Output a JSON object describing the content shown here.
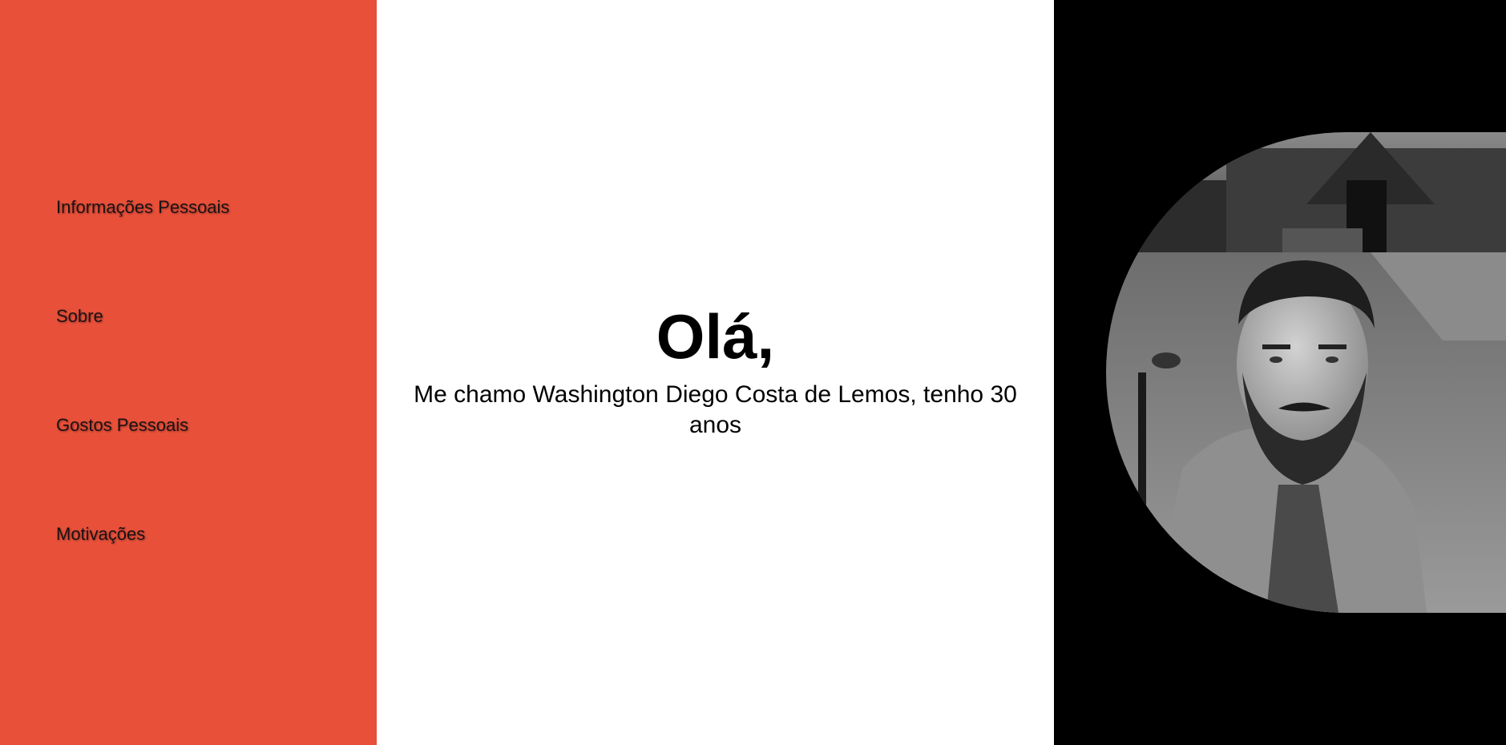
{
  "sidebar": {
    "background": "#e8503a",
    "items": [
      {
        "label": "Informações Pessoais"
      },
      {
        "label": "Sobre"
      },
      {
        "label": "Gostos Pessoais"
      },
      {
        "label": "Motivações"
      }
    ]
  },
  "main": {
    "greeting": "Olá,",
    "intro": "Me chamo Washington Diego Costa de Lemos, tenho 30 anos"
  },
  "profile_photo": {
    "icon": "profile-photo",
    "style": "black-and-white"
  }
}
